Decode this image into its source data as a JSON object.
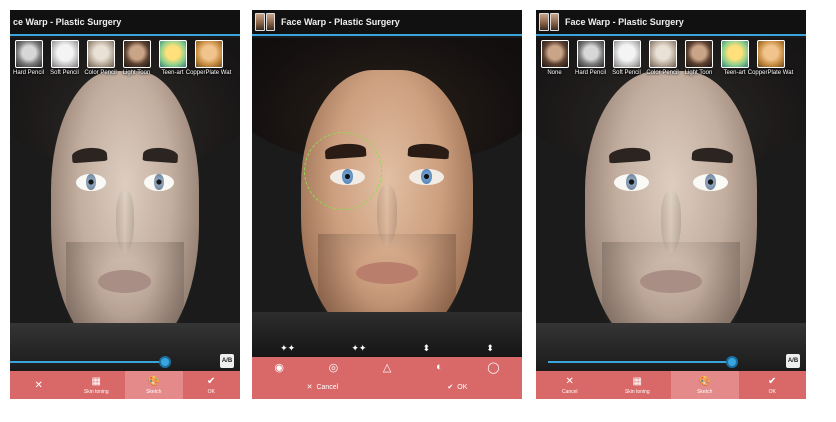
{
  "app": {
    "title": "Face Warp - Plastic Surgery",
    "title_left_cropped": "ce Warp - Plastic Surgery"
  },
  "screen1": {
    "filters": [
      "Hard Pencil",
      "Soft Pencil",
      "Color Pencil",
      "Light Toon",
      "Teen-art",
      "CopperPlate Wat"
    ],
    "slider_fraction": 0.72,
    "compare_label": "A/B",
    "bottom": [
      {
        "icon": "✕",
        "label": ""
      },
      {
        "icon": "▦",
        "label": "Skin toning"
      },
      {
        "icon": "🎨",
        "label": "Sketch"
      },
      {
        "icon": "✔",
        "label": "OK"
      }
    ]
  },
  "screen2": {
    "tool_arrows": [
      "✦✦",
      "✦✦",
      "⬍",
      "⬍"
    ],
    "tools": [
      "◉",
      "◎",
      "△",
      "◐",
      "◯"
    ],
    "cancel_label": "Cancel",
    "ok_label": "OK"
  },
  "screen3": {
    "filters": [
      "None",
      "Hard Pencil",
      "Soft Pencil",
      "Color Pencil",
      "Light Toon",
      "Teen-art",
      "CopperPlate Wat"
    ],
    "slider_fraction": 0.9,
    "compare_label": "A/B",
    "bottom": [
      {
        "icon": "✕",
        "label": "Cancel"
      },
      {
        "icon": "▦",
        "label": "Skin toning"
      },
      {
        "icon": "🎨",
        "label": "Sketch"
      },
      {
        "icon": "✔",
        "label": "OK"
      }
    ]
  },
  "colors": {
    "accent_blue": "#3aa4dc",
    "bar_red": "#d96868",
    "warp_green": "#8fdc4c"
  }
}
